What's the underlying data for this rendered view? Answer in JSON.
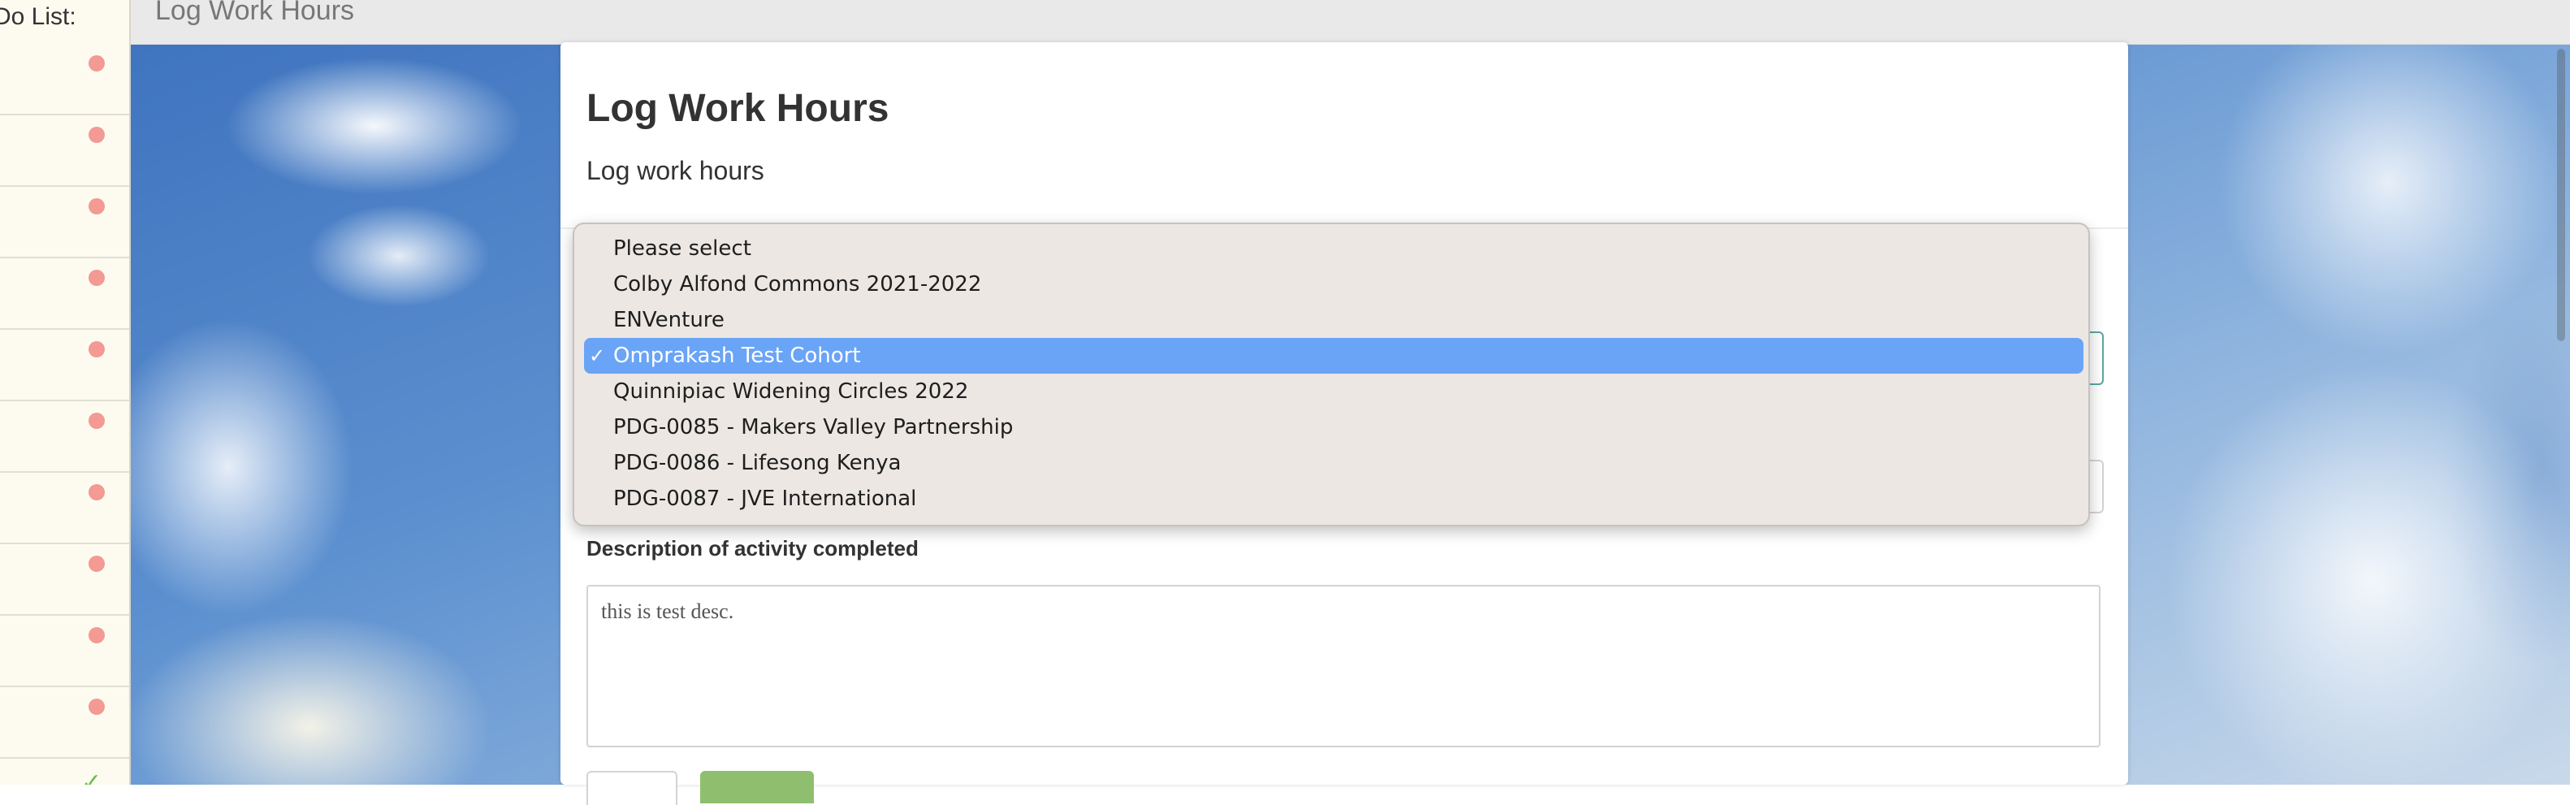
{
  "sidebar": {
    "title": "Do List:",
    "items_count_label": "",
    "dot_color": "#f29a93",
    "check_color": "#6cbf4a"
  },
  "topbar": {
    "title": "Log Work Hours"
  },
  "card": {
    "title": "Log Work Hours",
    "subtitle": "Log work hours",
    "description_label": "Description of activity completed",
    "description_value": "this is test desc."
  },
  "dropdown": {
    "options": [
      "Please select",
      "Colby Alfond Commons 2021-2022",
      "ENVenture",
      "Omprakash Test Cohort",
      "Quinnipiac Widening Circles 2022",
      "PDG-0085 - Makers Valley Partnership",
      "PDG-0086 - Lifesong Kenya",
      "PDG-0087 - JVE International"
    ],
    "selected": "Omprakash Test Cohort",
    "highlight_color": "#6aa4f6"
  },
  "icons": {
    "selected_check": "✓",
    "select_chevron": "⌄",
    "todo_done_check": "✓"
  },
  "colors": {
    "submit_button": "#8fbf6e",
    "select_focus_border": "#5aa7a0"
  }
}
